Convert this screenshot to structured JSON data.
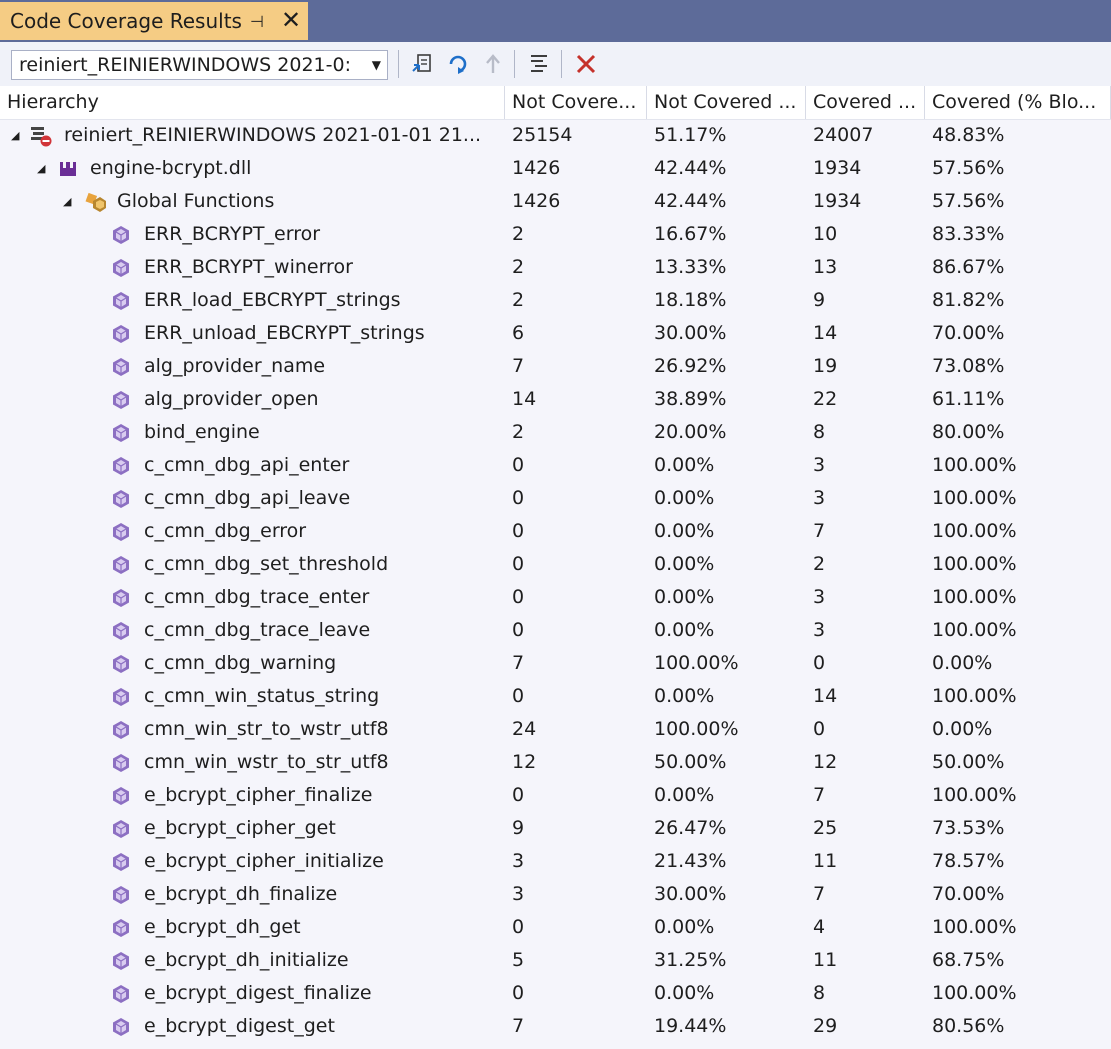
{
  "tab": {
    "title": "Code Coverage Results",
    "pin_glyph": "⊣",
    "close_glyph": "✕"
  },
  "toolbar": {
    "run_selector_value": "reinier­t_REINIERWINDOWS 2021-0:"
  },
  "columns": [
    "Hierarchy",
    "Not Covere...",
    "Not Covered ...",
    "Covered ...",
    "Covered (% Blo..."
  ],
  "rows": [
    {
      "level": 0,
      "type": "run",
      "name": "reiniert_REINIERWINDOWS 2021-01-01 21...",
      "nc": "25154",
      "ncp": "51.17%",
      "c": "24007",
      "cp": "48.83%"
    },
    {
      "level": 1,
      "type": "module",
      "name": "engine-bcrypt.dll",
      "nc": "1426",
      "ncp": "42.44%",
      "c": "1934",
      "cp": "57.56%"
    },
    {
      "level": 2,
      "type": "namespace",
      "name": "Global Functions",
      "nc": "1426",
      "ncp": "42.44%",
      "c": "1934",
      "cp": "57.56%"
    },
    {
      "level": 3,
      "type": "function",
      "name": "ERR_BCRYPT_error",
      "nc": "2",
      "ncp": "16.67%",
      "c": "10",
      "cp": "83.33%"
    },
    {
      "level": 3,
      "type": "function",
      "name": "ERR_BCRYPT_winerror",
      "nc": "2",
      "ncp": "13.33%",
      "c": "13",
      "cp": "86.67%"
    },
    {
      "level": 3,
      "type": "function",
      "name": "ERR_load_EBCRYPT_strings",
      "nc": "2",
      "ncp": "18.18%",
      "c": "9",
      "cp": "81.82%"
    },
    {
      "level": 3,
      "type": "function",
      "name": "ERR_unload_EBCRYPT_strings",
      "nc": "6",
      "ncp": "30.00%",
      "c": "14",
      "cp": "70.00%"
    },
    {
      "level": 3,
      "type": "function",
      "name": "alg_provider_name",
      "nc": "7",
      "ncp": "26.92%",
      "c": "19",
      "cp": "73.08%"
    },
    {
      "level": 3,
      "type": "function",
      "name": "alg_provider_open",
      "nc": "14",
      "ncp": "38.89%",
      "c": "22",
      "cp": "61.11%"
    },
    {
      "level": 3,
      "type": "function",
      "name": "bind_engine",
      "nc": "2",
      "ncp": "20.00%",
      "c": "8",
      "cp": "80.00%"
    },
    {
      "level": 3,
      "type": "function",
      "name": "c_cmn_dbg_api_enter",
      "nc": "0",
      "ncp": "0.00%",
      "c": "3",
      "cp": "100.00%"
    },
    {
      "level": 3,
      "type": "function",
      "name": "c_cmn_dbg_api_leave",
      "nc": "0",
      "ncp": "0.00%",
      "c": "3",
      "cp": "100.00%"
    },
    {
      "level": 3,
      "type": "function",
      "name": "c_cmn_dbg_error",
      "nc": "0",
      "ncp": "0.00%",
      "c": "7",
      "cp": "100.00%"
    },
    {
      "level": 3,
      "type": "function",
      "name": "c_cmn_dbg_set_threshold",
      "nc": "0",
      "ncp": "0.00%",
      "c": "2",
      "cp": "100.00%"
    },
    {
      "level": 3,
      "type": "function",
      "name": "c_cmn_dbg_trace_enter",
      "nc": "0",
      "ncp": "0.00%",
      "c": "3",
      "cp": "100.00%"
    },
    {
      "level": 3,
      "type": "function",
      "name": "c_cmn_dbg_trace_leave",
      "nc": "0",
      "ncp": "0.00%",
      "c": "3",
      "cp": "100.00%"
    },
    {
      "level": 3,
      "type": "function",
      "name": "c_cmn_dbg_warning",
      "nc": "7",
      "ncp": "100.00%",
      "c": "0",
      "cp": "0.00%"
    },
    {
      "level": 3,
      "type": "function",
      "name": "c_cmn_win_status_string",
      "nc": "0",
      "ncp": "0.00%",
      "c": "14",
      "cp": "100.00%"
    },
    {
      "level": 3,
      "type": "function",
      "name": "cmn_win_str_to_wstr_utf8",
      "nc": "24",
      "ncp": "100.00%",
      "c": "0",
      "cp": "0.00%"
    },
    {
      "level": 3,
      "type": "function",
      "name": "cmn_win_wstr_to_str_utf8",
      "nc": "12",
      "ncp": "50.00%",
      "c": "12",
      "cp": "50.00%"
    },
    {
      "level": 3,
      "type": "function",
      "name": "e_bcrypt_cipher_finalize",
      "nc": "0",
      "ncp": "0.00%",
      "c": "7",
      "cp": "100.00%"
    },
    {
      "level": 3,
      "type": "function",
      "name": "e_bcrypt_cipher_get",
      "nc": "9",
      "ncp": "26.47%",
      "c": "25",
      "cp": "73.53%"
    },
    {
      "level": 3,
      "type": "function",
      "name": "e_bcrypt_cipher_initialize",
      "nc": "3",
      "ncp": "21.43%",
      "c": "11",
      "cp": "78.57%"
    },
    {
      "level": 3,
      "type": "function",
      "name": "e_bcrypt_dh_finalize",
      "nc": "3",
      "ncp": "30.00%",
      "c": "7",
      "cp": "70.00%"
    },
    {
      "level": 3,
      "type": "function",
      "name": "e_bcrypt_dh_get",
      "nc": "0",
      "ncp": "0.00%",
      "c": "4",
      "cp": "100.00%"
    },
    {
      "level": 3,
      "type": "function",
      "name": "e_bcrypt_dh_initialize",
      "nc": "5",
      "ncp": "31.25%",
      "c": "11",
      "cp": "68.75%"
    },
    {
      "level": 3,
      "type": "function",
      "name": "e_bcrypt_digest_finalize",
      "nc": "0",
      "ncp": "0.00%",
      "c": "8",
      "cp": "100.00%"
    },
    {
      "level": 3,
      "type": "function",
      "name": "e_bcrypt_digest_get",
      "nc": "7",
      "ncp": "19.44%",
      "c": "29",
      "cp": "80.56%"
    }
  ]
}
